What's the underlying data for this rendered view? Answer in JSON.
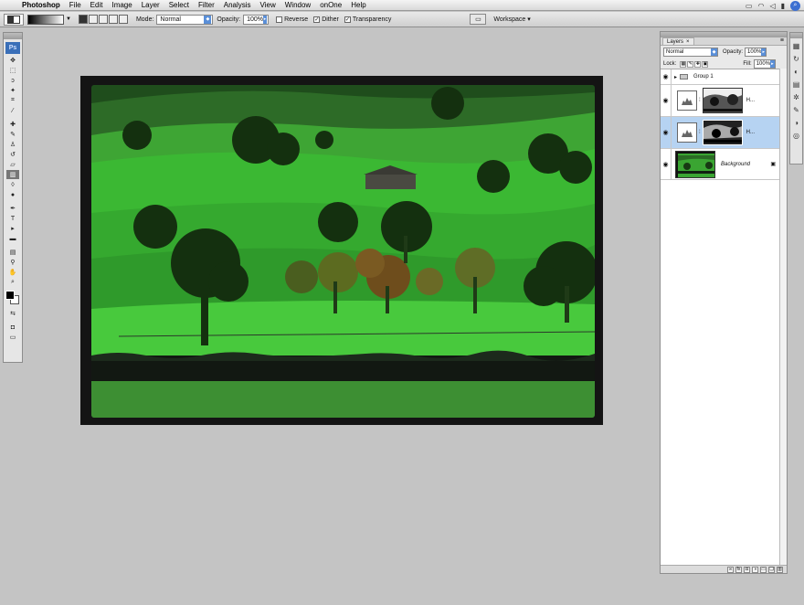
{
  "menubar": {
    "app_name": "Photoshop",
    "items": [
      "File",
      "Edit",
      "Image",
      "Layer",
      "Select",
      "Filter",
      "Analysis",
      "View",
      "Window",
      "onOne",
      "Help"
    ]
  },
  "options": {
    "mode_label": "Mode:",
    "mode_value": "Normal",
    "opacity_label": "Opacity:",
    "opacity_value": "100%",
    "reverse_label": "Reverse",
    "dither_label": "Dither",
    "transparency_label": "Transparency",
    "workspace_label": "Workspace ▾"
  },
  "layers_panel": {
    "tab_label": "Layers",
    "blend_mode": "Normal",
    "opacity_label": "Opacity:",
    "opacity_value": "100%",
    "lock_label": "Lock:",
    "fill_label": "Fill:",
    "fill_value": "100%",
    "layers": [
      {
        "name": "Group 1",
        "kind": "group"
      },
      {
        "name": "H...",
        "kind": "adjustment"
      },
      {
        "name": "H...",
        "kind": "adjustment",
        "selected": true
      },
      {
        "name": "Background",
        "kind": "pixel",
        "locked": true
      }
    ]
  },
  "colors": {
    "foreground": "#000000",
    "background": "#ffffff",
    "selection": "#b6d3f2",
    "accent": "#5a8fd8"
  }
}
